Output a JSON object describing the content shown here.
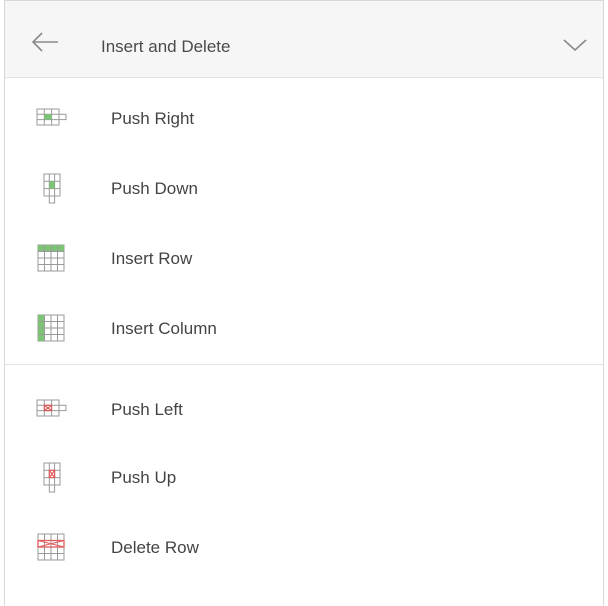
{
  "header": {
    "title": "Insert and Delete",
    "back_icon": "back-arrow-icon",
    "collapse_icon": "chevron-down-icon"
  },
  "insert_group": {
    "items": [
      {
        "label": "Push Right",
        "icon": "push-right-icon"
      },
      {
        "label": "Push Down",
        "icon": "push-down-icon"
      },
      {
        "label": "Insert Row",
        "icon": "insert-row-icon"
      },
      {
        "label": "Insert Column",
        "icon": "insert-column-icon"
      }
    ]
  },
  "delete_group": {
    "items": [
      {
        "label": "Push Left",
        "icon": "push-left-icon"
      },
      {
        "label": "Push Up",
        "icon": "push-up-icon"
      },
      {
        "label": "Delete Row",
        "icon": "delete-row-icon"
      }
    ]
  },
  "colors": {
    "insert_accent": "#7cc576",
    "delete_accent": "#e25b5b",
    "grid_line": "#9a9a9a",
    "header_bg": "#f6f6f6"
  }
}
